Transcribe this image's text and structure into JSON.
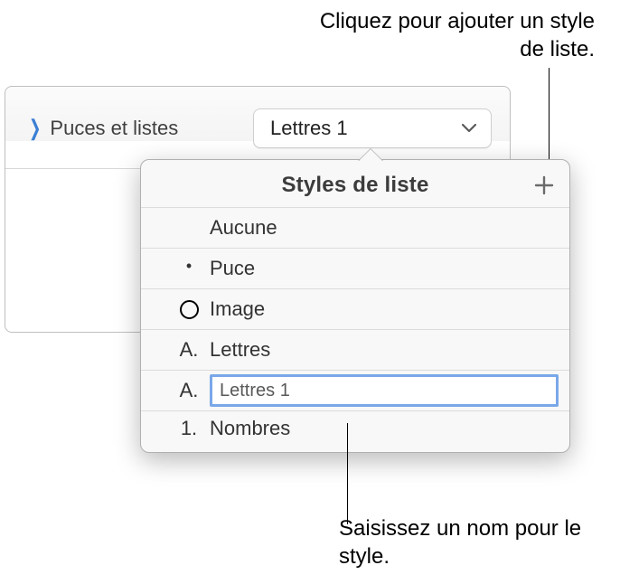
{
  "annotations": {
    "top": "Cliquez pour ajouter un style de liste.",
    "bottom": "Saisissez un nom pour le style."
  },
  "header": {
    "label": "Puces et listes",
    "selected": "Lettres 1"
  },
  "popover": {
    "title": "Styles de liste",
    "items": [
      {
        "marker": "",
        "label": "Aucune"
      },
      {
        "marker": "•",
        "label": "Puce"
      },
      {
        "marker": "○",
        "label": "Image"
      },
      {
        "marker": "A.",
        "label": "Lettres"
      },
      {
        "marker": "A.",
        "label": "Lettres 1",
        "editable": true
      },
      {
        "marker": "1.",
        "label": "Nombres"
      }
    ]
  }
}
